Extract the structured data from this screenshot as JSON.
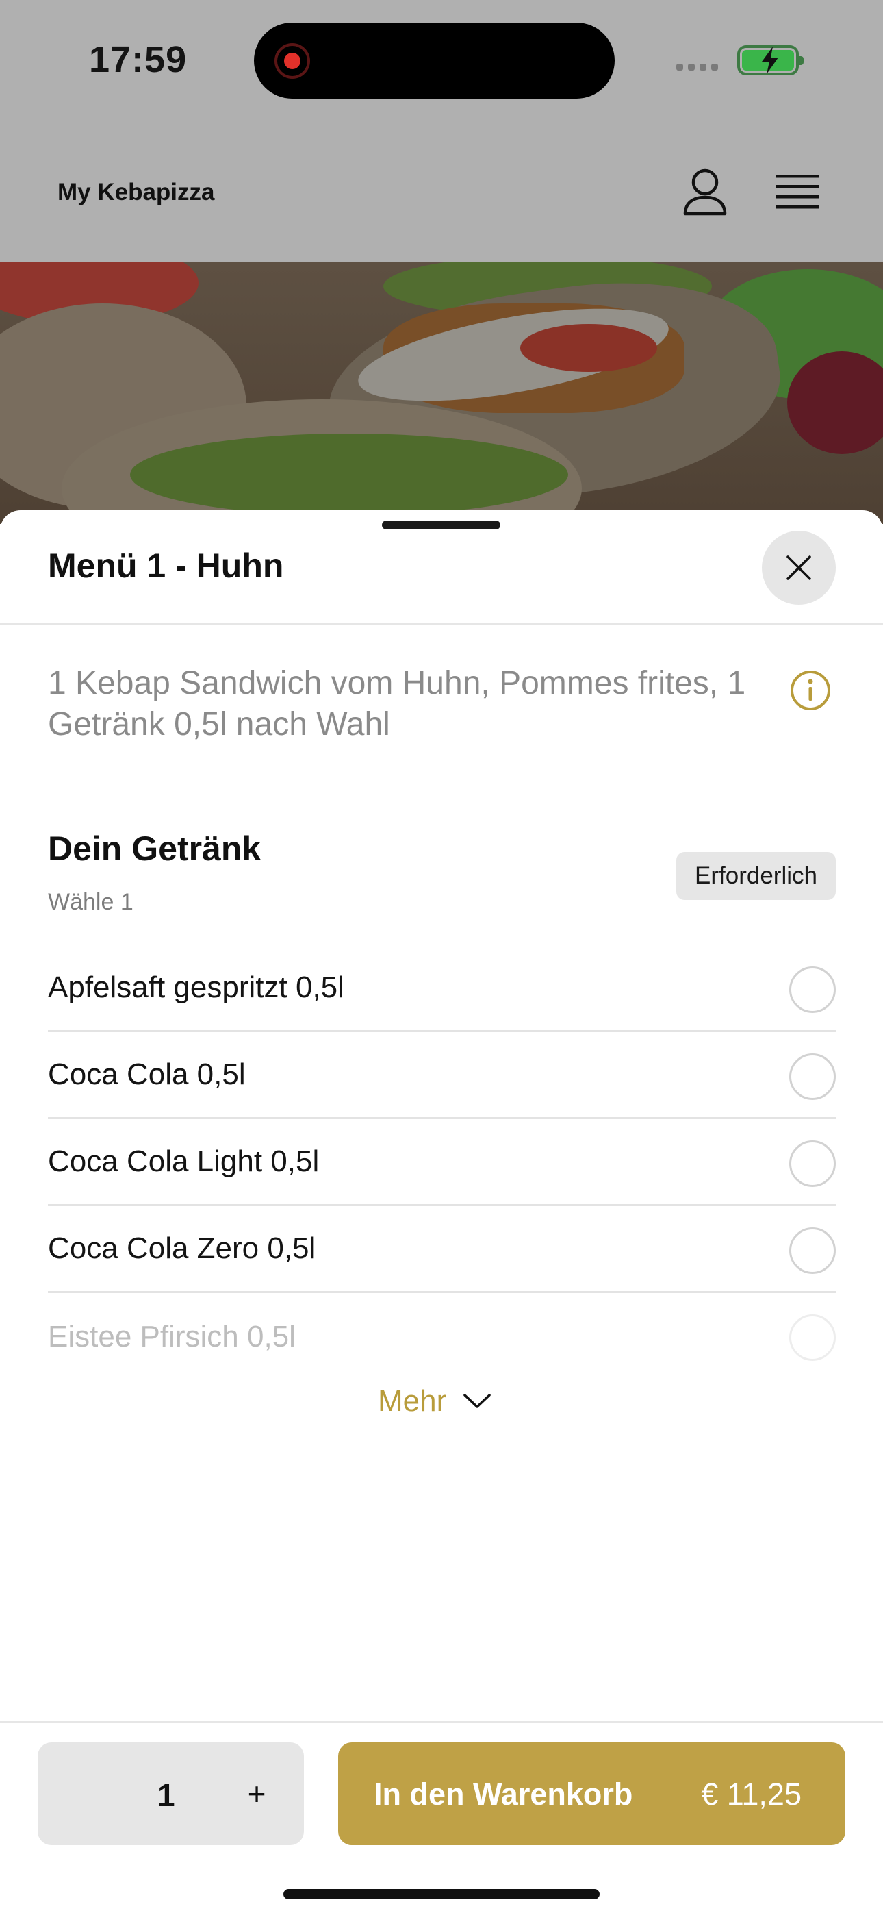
{
  "status_bar": {
    "time": "17:59"
  },
  "header": {
    "app_title": "My Kebapizza"
  },
  "sheet": {
    "title": "Menü 1 - Huhn",
    "description": "1 Kebap Sandwich vom Huhn, Pommes frites, 1 Getränk 0,5l nach Wahl",
    "group": {
      "title": "Dein Getränk",
      "subtitle": "Wähle 1",
      "badge": "Erforderlich",
      "options": [
        "Apfelsaft gespritzt 0,5l",
        "Coca Cola 0,5l",
        "Coca Cola Light 0,5l",
        "Coca Cola Zero 0,5l",
        "Eistee Pfirsich 0,5l"
      ],
      "more_label": "Mehr"
    }
  },
  "footer": {
    "quantity": "1",
    "plus_label": "+",
    "cart_label": "In den Warenkorb",
    "price": "€ 11,25"
  },
  "colors": {
    "accent": "#bfa146",
    "accent_text": "#b89c3b",
    "overlay_gray": "#b0b0b0",
    "battery_green": "#3ab54a",
    "record_red": "#e2312a"
  },
  "icons": {
    "profile": "person-outline-icon",
    "menu": "hamburger-menu-icon",
    "close": "close-x-icon",
    "info": "info-circle-icon",
    "more": "chevron-down-icon"
  }
}
